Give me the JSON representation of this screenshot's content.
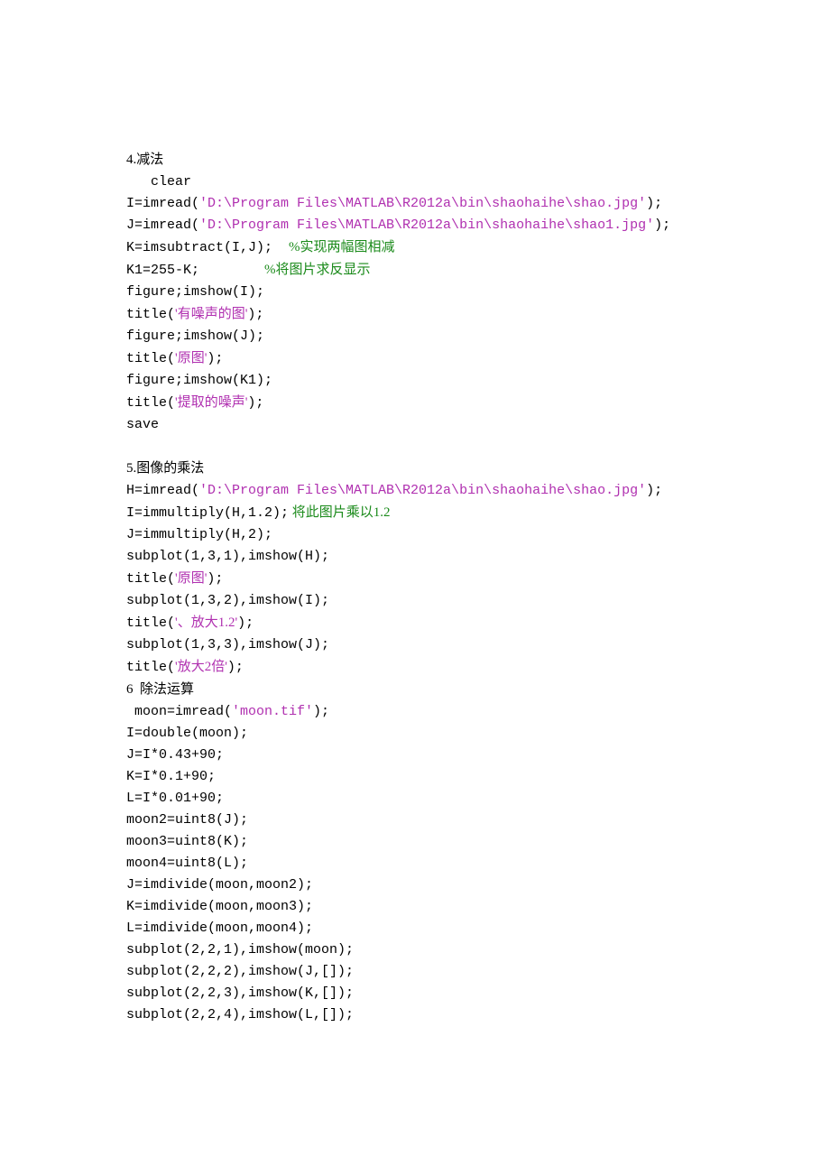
{
  "sec4": {
    "title": "4.减法",
    "clear": "clear",
    "l1a": "I=imread(",
    "l1b": "'D:\\Program Files\\MATLAB\\R2012a\\bin\\shaohaihe\\shao.jpg'",
    "l1c": ");",
    "l2a": "J=imread(",
    "l2b": "'D:\\Program Files\\MATLAB\\R2012a\\bin\\shaohaihe\\shao1.jpg'",
    "l2c": ");",
    "l3a": "K=imsubtract(I,J);  ",
    "l3b": "%实现两幅图相减",
    "l4a": "K1=255-K;        ",
    "l4b": "%将图片求反显示",
    "l5": "figure;imshow(I);",
    "l6a": "title(",
    "l6b": "'有噪声的图'",
    "l6c": ");",
    "l7": "figure;imshow(J);",
    "l8a": "title(",
    "l8b": "'原图'",
    "l8c": ");",
    "l9": "figure;imshow(K1);",
    "l10a": "title(",
    "l10b": "'提取的噪声'",
    "l10c": ");",
    "l11": "save"
  },
  "sec5": {
    "title": "5.图像的乘法",
    "l1a": "H=imread(",
    "l1b": "'D:\\Program Files\\MATLAB\\R2012a\\bin\\shaohaihe\\shao.jpg'",
    "l1c": ");",
    "l2a": "I=immultiply(H,1.2);",
    "l2b": " 将此图片乘以1.2",
    "l3": "J=immultiply(H,2);",
    "l4": "subplot(1,3,1),imshow(H);",
    "l5a": "title(",
    "l5b": "'原图'",
    "l5c": ");",
    "l6": "subplot(1,3,2),imshow(I);",
    "l7a": "title(",
    "l7b": "'、放大1.2'",
    "l7c": ");",
    "l8": "subplot(1,3,3),imshow(J);",
    "l9a": "title(",
    "l9b": "'放大2倍'",
    "l9c": ");"
  },
  "sec6": {
    "title": "6  除法运算",
    "l1a": "moon=imread(",
    "l1b": "'moon.tif'",
    "l1c": ");",
    "l2": "I=double(moon);",
    "l3": "J=I*0.43+90;",
    "l4": "K=I*0.1+90;",
    "l5": "L=I*0.01+90;",
    "l6": "moon2=uint8(J);",
    "l7": "moon3=uint8(K);",
    "l8": "moon4=uint8(L);",
    "l9": "J=imdivide(moon,moon2);",
    "l10": "K=imdivide(moon,moon3);",
    "l11": "L=imdivide(moon,moon4);",
    "l12": "subplot(2,2,1),imshow(moon);",
    "l13": "subplot(2,2,2),imshow(J,[]);",
    "l14": "subplot(2,2,3),imshow(K,[]);",
    "l15": "subplot(2,2,4),imshow(L,[]);"
  }
}
